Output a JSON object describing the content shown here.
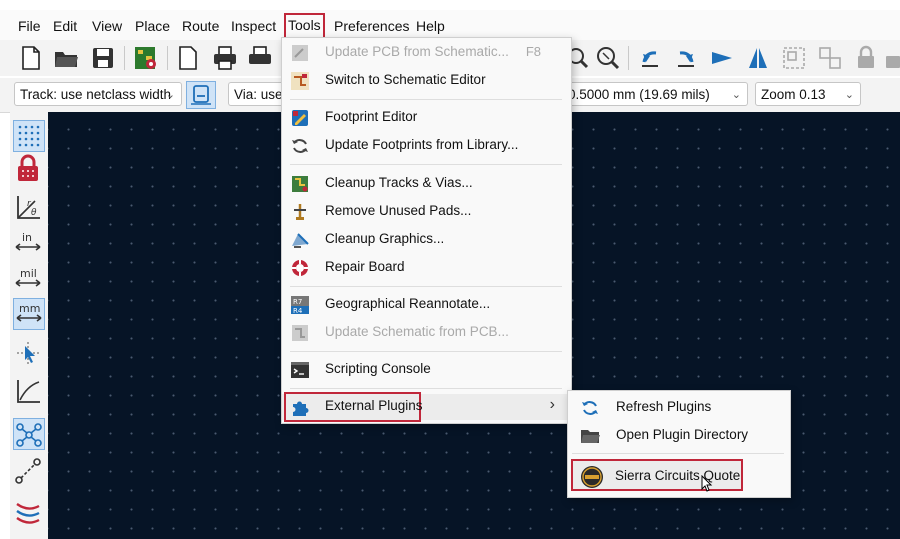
{
  "menubar": {
    "items": [
      "File",
      "Edit",
      "View",
      "Place",
      "Route",
      "Inspect",
      "Tools",
      "Preferences",
      "Help"
    ],
    "active": "Tools"
  },
  "options": {
    "track": "Track: use netclass width",
    "via": "Via: use",
    "grid": "0.5000 mm (19.69 mils)",
    "zoom": "Zoom 0.13"
  },
  "left_toolbar": {
    "in_label": "in",
    "mil_label": "mil",
    "mm_label": "mm"
  },
  "tools_menu": {
    "items": [
      {
        "label": "Update PCB from Schematic...",
        "shortcut": "F8",
        "disabled": true,
        "icon": "update-pcb-icon"
      },
      {
        "label": "Switch to Schematic Editor",
        "disabled": false,
        "icon": "schematic-editor-icon"
      },
      {
        "label": "Footprint Editor",
        "disabled": false,
        "icon": "footprint-editor-icon"
      },
      {
        "label": "Update Footprints from Library...",
        "disabled": false,
        "icon": "refresh-icon"
      },
      {
        "label": "Cleanup Tracks & Vias...",
        "disabled": false,
        "icon": "cleanup-tracks-icon"
      },
      {
        "label": "Remove Unused Pads...",
        "disabled": false,
        "icon": "remove-pads-icon"
      },
      {
        "label": "Cleanup Graphics...",
        "disabled": false,
        "icon": "cleanup-graphics-icon"
      },
      {
        "label": "Repair Board",
        "disabled": false,
        "icon": "repair-board-icon"
      },
      {
        "label": "Geographical Reannotate...",
        "disabled": false,
        "icon": "reannotate-icon"
      },
      {
        "label": "Update Schematic from PCB...",
        "disabled": true,
        "icon": "update-schematic-icon"
      },
      {
        "label": "Scripting Console",
        "disabled": false,
        "icon": "console-icon"
      },
      {
        "label": "External Plugins",
        "disabled": false,
        "icon": "puzzle-icon",
        "submenu_arrow": "›"
      }
    ]
  },
  "plugins_submenu": {
    "items": [
      {
        "label": "Refresh Plugins",
        "icon": "refresh-icon"
      },
      {
        "label": "Open Plugin Directory",
        "icon": "folder-icon"
      },
      {
        "label": "Sierra Circuits Quote",
        "icon": "sierra-circuits-icon"
      }
    ]
  },
  "colors": {
    "highlight": "#c0273a",
    "canvas": "#061426",
    "grid_dot": "#4a5a70"
  }
}
